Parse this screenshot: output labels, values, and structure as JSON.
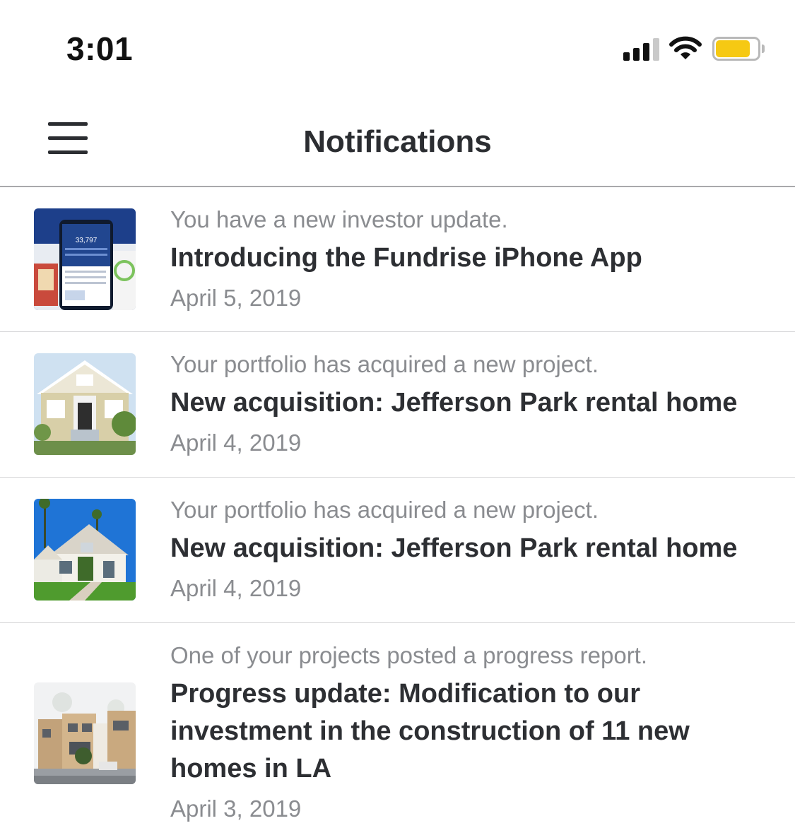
{
  "status_bar": {
    "time": "3:01",
    "icons": [
      "cellular-signal-icon",
      "wifi-icon",
      "battery-icon"
    ],
    "battery_color": "#f6c913"
  },
  "header": {
    "title": "Notifications",
    "menu_icon": "hamburger-menu-icon"
  },
  "notifications": [
    {
      "subtitle": "You have a new investor update.",
      "title": "Introducing the Fundrise iPhone App",
      "date": "April 5, 2019",
      "image": "app-screenshot-thumbnail"
    },
    {
      "subtitle": "Your portfolio has acquired a new project.",
      "title": "New acquisition: Jefferson Park rental home",
      "date": "April 4, 2019",
      "image": "house-photo-thumbnail"
    },
    {
      "subtitle": "Your portfolio has acquired a new project.",
      "title": "New acquisition: Jefferson Park rental home",
      "date": "April 4, 2019",
      "image": "house-photo-thumbnail"
    },
    {
      "subtitle": "One of your projects posted a progress report.",
      "title": "Progress update: Modification to our investment in the construction of 11 new homes in LA",
      "date": "April 3, 2019",
      "image": "construction-rendering-thumbnail"
    }
  ],
  "colors": {
    "title_text": "#2d2f33",
    "secondary_text": "#8a8c90",
    "divider": "#d6d6d8"
  }
}
